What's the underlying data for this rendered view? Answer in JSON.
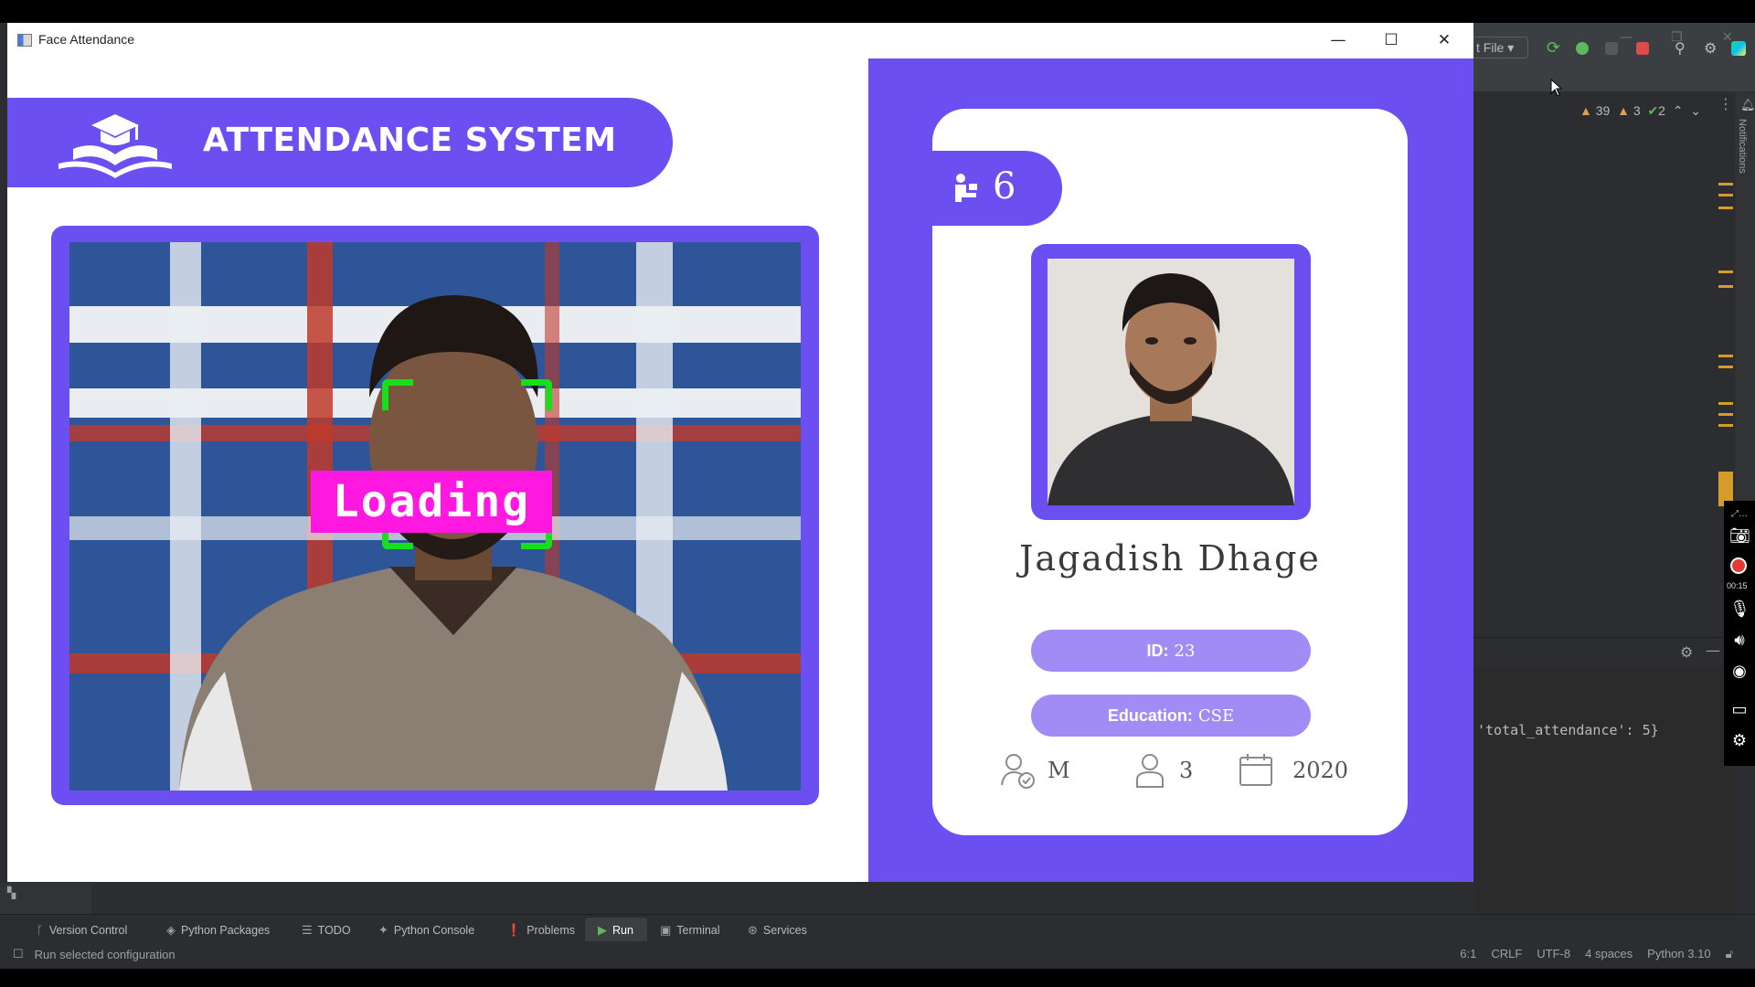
{
  "app": {
    "window_title": "Face Attendance",
    "banner_title": "ATTENDANCE SYSTEM",
    "camera": {
      "face_status": "Loading"
    },
    "student": {
      "total_attendance": "6",
      "name": "Jagadish  Dhage",
      "id_label": "ID:",
      "id_value": "23",
      "education_label": "Education:",
      "education_value": "CSE",
      "gender": "M",
      "year": "3",
      "starting_year": "2020"
    },
    "colors": {
      "accent": "#6c4ff0",
      "pill": "#a18cf5",
      "face_box": "#18e018",
      "face_label": "#ff19e0"
    }
  },
  "ide": {
    "run_config": "t File",
    "inspections": {
      "warnings": "39",
      "weak_warnings": "3",
      "ok": "2"
    },
    "notifications_label": "Notifications",
    "run_output": "'total_attendance': 5}",
    "record_time": "00:15",
    "tool_tabs": [
      {
        "label": "Version Control",
        "icon": "branch-icon"
      },
      {
        "label": "Python Packages",
        "icon": "packages-icon"
      },
      {
        "label": "TODO",
        "icon": "list-icon"
      },
      {
        "label": "Python Console",
        "icon": "console-icon"
      },
      {
        "label": "Problems",
        "icon": "alert-icon"
      },
      {
        "label": "Run",
        "icon": "run-icon"
      },
      {
        "label": "Terminal",
        "icon": "terminal-icon"
      },
      {
        "label": "Services",
        "icon": "services-icon"
      }
    ],
    "status": {
      "message": "Run selected configuration",
      "position": "6:1",
      "line_sep": "CRLF",
      "encoding": "UTF-8",
      "indent": "4 spaces",
      "interpreter": "Python 3.10"
    }
  }
}
